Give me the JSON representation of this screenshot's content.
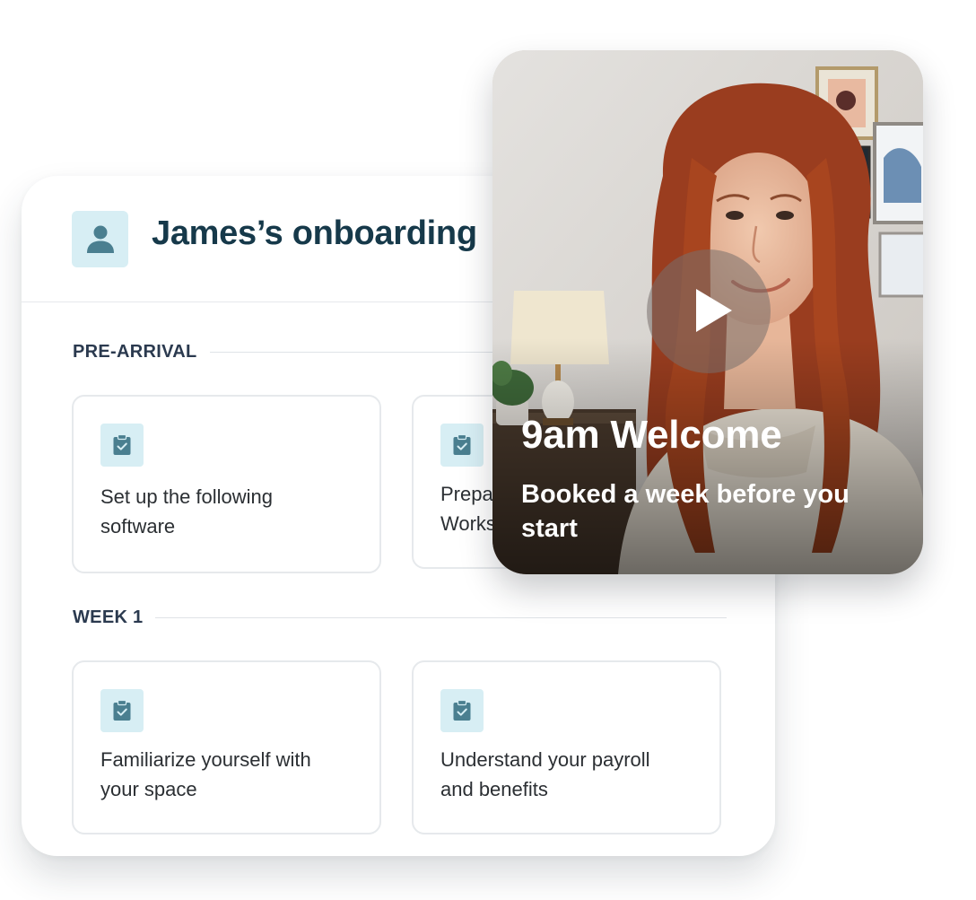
{
  "header": {
    "title": "James’s onboarding",
    "avatar_icon": "user-icon"
  },
  "sections": [
    {
      "label": "PRE-ARRIVAL",
      "tasks": [
        {
          "icon": "clipboard-check-icon",
          "text": "Set up the following\nsoftware"
        },
        {
          "icon": "clipboard-check-icon",
          "text": "Prepa\nWorks"
        }
      ]
    },
    {
      "label": "WEEK 1",
      "tasks": [
        {
          "icon": "clipboard-check-icon",
          "text": "Familiarize yourself with\nyour space"
        },
        {
          "icon": "clipboard-check-icon",
          "text": "Understand your payroll\nand benefits"
        }
      ]
    }
  ],
  "video": {
    "title": "9am Welcome",
    "subtitle": "Booked a week before you start",
    "play_icon": "play-icon"
  },
  "colors": {
    "title": "#16394a",
    "icon_tile": "#d7eef4",
    "icon_fill": "#4a7f90",
    "section_label": "#2b3a4f"
  }
}
